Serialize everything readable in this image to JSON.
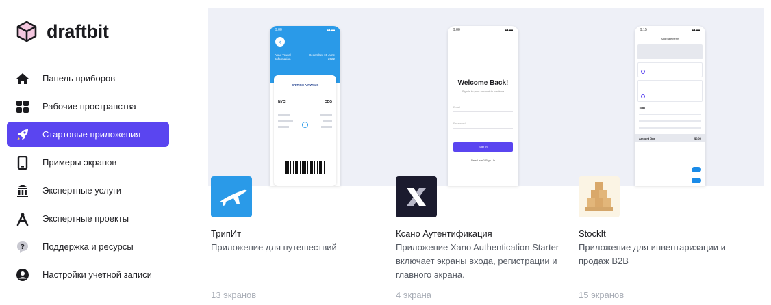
{
  "brand": {
    "name": "draftbit"
  },
  "nav": {
    "items": [
      {
        "label": "Панель приборов",
        "icon": "home-icon"
      },
      {
        "label": "Рабочие пространства",
        "icon": "grid-icon"
      },
      {
        "label": "Стартовые приложения",
        "icon": "rocket-icon",
        "active": true
      },
      {
        "label": "Примеры экранов",
        "icon": "phone-icon"
      },
      {
        "label": "Экспертные услуги",
        "icon": "building-icon"
      },
      {
        "label": "Экспертные проекты",
        "icon": "compass-icon"
      },
      {
        "label": "Поддержка и ресурсы",
        "icon": "help-icon"
      },
      {
        "label": "Настройки учетной записи",
        "icon": "user-icon"
      }
    ]
  },
  "cards": [
    {
      "title": "ТрипИт",
      "description": "Приложение для путешествий",
      "count": "13 экранов",
      "icon": "airplane-icon",
      "preview": {
        "time": "9:00",
        "header_left": "Your Travel Information",
        "header_right": "December 15 June 2022",
        "airline": "BRITISH AIRWAYS",
        "from": "NYC",
        "to": "CDG"
      }
    },
    {
      "title": "Ксано Аутентификация",
      "description": "Приложение Xano Authentication Starter — включает экраны входа, регистрации и главного экрана.",
      "count": "4 экрана",
      "icon": "x-logo-icon",
      "preview": {
        "time": "9:00",
        "heading": "Welcome Back!",
        "subheading": "Sign in to your account to continue",
        "email_placeholder": "Email",
        "password_placeholder": "Password",
        "button": "Sign In",
        "footer": "New User? Sign Up"
      }
    },
    {
      "title": "StockIt",
      "description": "Приложение для инвентаризации и продаж B2B",
      "count": "15 экранов",
      "icon": "boxes-icon",
      "preview": {
        "time": "9:15",
        "header": "Add Sale Items",
        "amount_due": "Amount Due",
        "amount_value": "$0.00",
        "total_label": "Total"
      }
    }
  ],
  "colors": {
    "accent": "#5a45f0",
    "tripit": "#2a9ae8",
    "xano": "#1b1b2e"
  }
}
